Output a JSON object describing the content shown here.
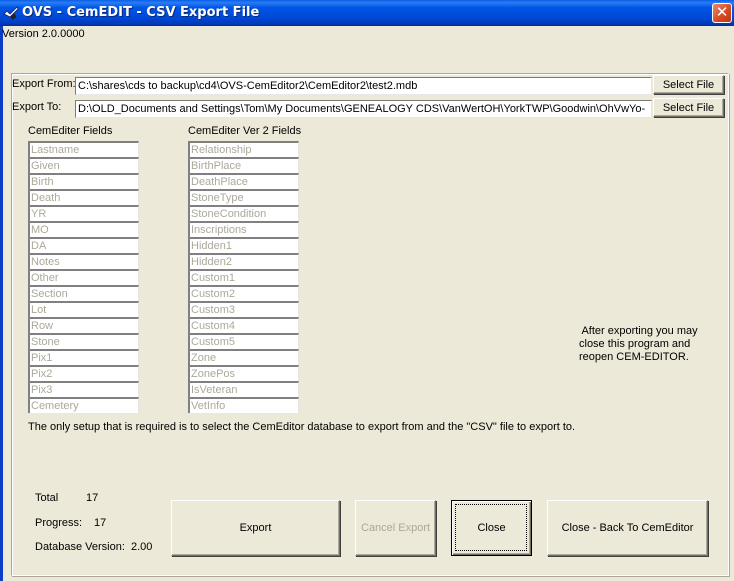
{
  "window": {
    "title": "OVS - CemEDIT - CSV Export File",
    "close_glyph": "✕",
    "icon": "app-icon"
  },
  "version_label": "Version 2.0.0000",
  "export_from": {
    "label": "Export From:",
    "value": "C:\\shares\\cds to backup\\cd4\\OVS-CemEditor2\\CemEditor2\\test2.mdb",
    "button": "Select File"
  },
  "export_to": {
    "label": "Export To:",
    "value": "D:\\OLD_Documents and Settings\\Tom\\My Documents\\GENEALOGY CDS\\VanWertOH\\YorkTWP\\Goodwin\\OhVwYo-",
    "button": "Select File"
  },
  "cemediter_fields": {
    "header": "CemEditer Fields",
    "items": [
      "Lastname",
      "Given",
      "Birth",
      "Death",
      "YR",
      "MO",
      "DA",
      "Notes",
      "Other",
      "Section",
      "Lot",
      "Row",
      "Stone",
      "Pix1",
      "Pix2",
      "Pix3",
      "Cemetery"
    ]
  },
  "ver2_fields": {
    "header": "CemEditer Ver 2 Fields",
    "items": [
      "Relationship",
      "BirthPlace",
      "DeathPlace",
      "StoneType",
      "StoneCondition",
      "Inscriptions",
      "Hidden1",
      "Hidden2",
      "Custom1",
      "Custom2",
      "Custom3",
      "Custom4",
      "Custom5",
      "Zone",
      "ZonePos",
      "IsVeteran",
      "VetInfo"
    ]
  },
  "after_note": [
    " After exporting you may",
    "close this program and",
    "reopen CEM-EDITOR."
  ],
  "setup_note": "The only setup that is required is to select the CemEditor database to export from and the \"CSV\" file to export to.",
  "stats": {
    "total_label": "Total",
    "total_value": "17",
    "progress_label": "Progress:",
    "progress_value": "17",
    "dbver_label": "Database Version:",
    "dbver_value": "2.00"
  },
  "buttons": {
    "export": "Export",
    "cancel_export": "Cancel Export",
    "close": "Close",
    "close_back": "Close - Back To CemEditor"
  },
  "colors": {
    "titlebar": "#0055e5",
    "face": "#ece9d8",
    "disabled_text": "#aca899",
    "close_button": "#d5471f"
  }
}
